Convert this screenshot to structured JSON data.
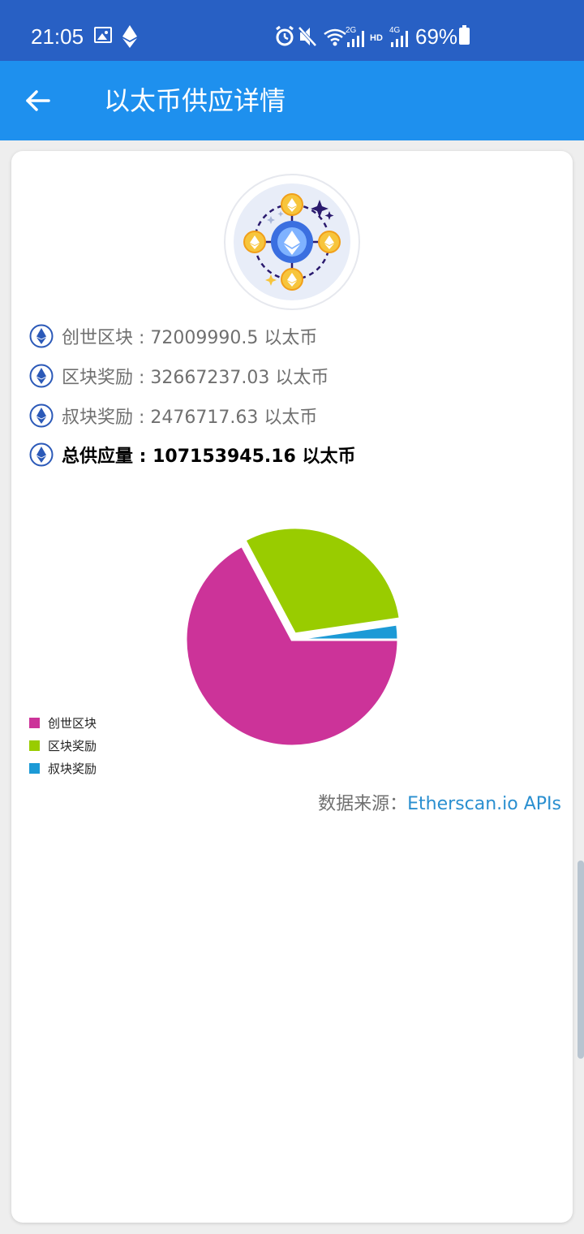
{
  "status_bar": {
    "time": "21:05",
    "battery": "69%",
    "icons": [
      "image-icon",
      "ethereum-icon",
      "alarm-icon",
      "mute-icon",
      "wifi-icon",
      "2g-signal-icon",
      "hd-icon",
      "4g-signal-icon",
      "battery-icon"
    ]
  },
  "app_bar": {
    "title": "以太币供应详情",
    "back_icon": "arrow-left-icon"
  },
  "supply": {
    "rows": [
      {
        "label": "创世区块 : 72009990.5 以太币"
      },
      {
        "label": "区块奖励 : 32667237.03 以太币"
      },
      {
        "label": "叔块奖励 : 2476717.63 以太币"
      }
    ],
    "total": "总供应量 : 107153945.16 以太币"
  },
  "chart_data": {
    "type": "pie",
    "categories": [
      "创世区块",
      "区块奖励",
      "叔块奖励"
    ],
    "values": [
      72009990.5,
      32667237.03,
      2476717.63
    ],
    "colors": [
      "#cc3399",
      "#99cc00",
      "#1c9ad6"
    ],
    "legend_position": "bottom-left",
    "start_angle_deg": 0,
    "direction": "clockwise",
    "explode_slice_index": 1
  },
  "source": {
    "prefix": "数据来源：",
    "link": "Etherscan.io APIs"
  },
  "colors": {
    "status_bar": "#2860c4",
    "app_bar": "#1e90ee",
    "link": "#2a8fd0"
  }
}
